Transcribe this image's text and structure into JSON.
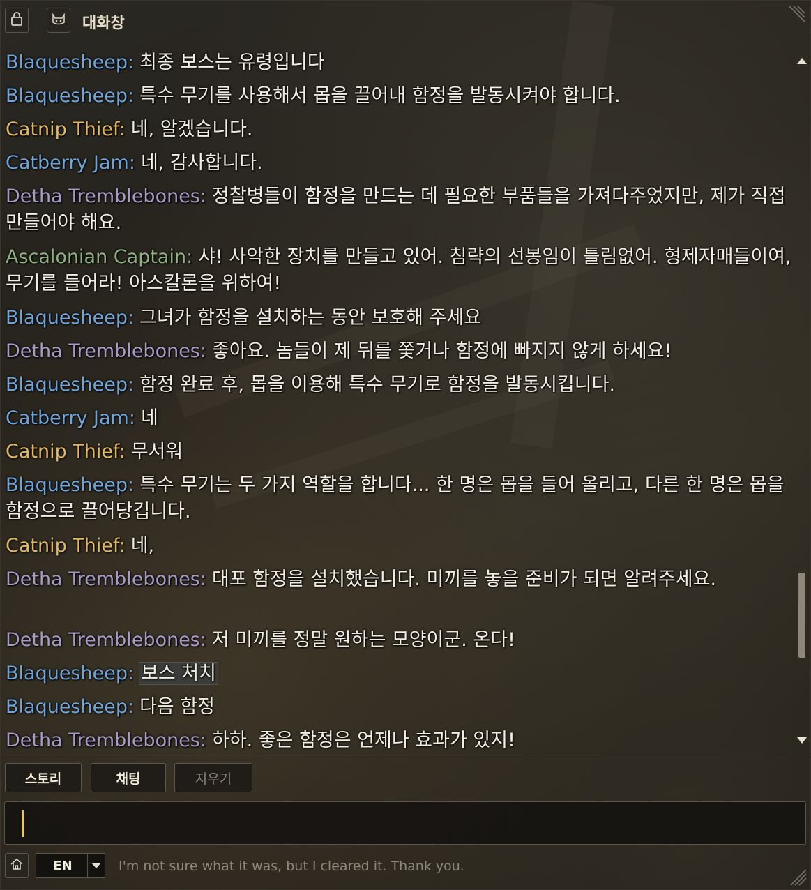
{
  "window": {
    "title": "대화창",
    "icons": {
      "lock": "lock-icon",
      "character": "cat-face-icon",
      "resize": "resize-grip-icon",
      "home": "home-icon"
    }
  },
  "colors": {
    "speaker_blue": "#6fa5d8",
    "speaker_gold": "#e0b861",
    "speaker_purple": "#a79ac5",
    "speaker_green": "#8fb27f",
    "message_text": "#f2ede2",
    "caret": "#e6c26a"
  },
  "messages": [
    {
      "speaker": "Blaquesheep:",
      "text": "최종 보스는 유령입니다"
    },
    {
      "speaker": "Blaquesheep:",
      "text": "특수 무기를 사용해서 몹을 끌어내 함정을 발동시켜야 합니다."
    },
    {
      "speaker": "Catnip Thief:",
      "text": "네, 알겠습니다."
    },
    {
      "speaker": "Catberry Jam:",
      "text": "네, 감사합니다."
    },
    {
      "speaker": "Detha Tremblebones:",
      "text": "정찰병들이 함정을 만드는 데 필요한 부품들을 가져다주었지만, 제가 직접 만들어야 해요."
    },
    {
      "speaker": "Ascalonian Captain:",
      "text": "샤! 사악한 장치를 만들고 있어. 침략의 선봉임이 틀림없어. 형제자매들이여, 무기를 들어라! 아스칼론을 위하여!"
    },
    {
      "speaker": "Blaquesheep:",
      "text": "그녀가 함정을 설치하는 동안 보호해 주세요"
    },
    {
      "speaker": "Detha Tremblebones:",
      "text": "좋아요. 놈들이 제 뒤를 쫓거나 함정에 빠지지 않게 하세요!"
    },
    {
      "speaker": "Blaquesheep:",
      "text": "함정 완료 후, 몹을 이용해 특수 무기로 함정을 발동시킵니다."
    },
    {
      "speaker": "Catberry Jam:",
      "text": "네"
    },
    {
      "speaker": "Catnip Thief:",
      "text": "무서워"
    },
    {
      "speaker": "Blaquesheep:",
      "text": "특수 무기는 두 가지 역할을 합니다... 한 명은 몹을 들어 올리고, 다른 한 명은 몹을 함정으로 끌어당깁니다."
    },
    {
      "speaker": "Catnip Thief:",
      "text": "네,"
    },
    {
      "speaker": "Detha Tremblebones:",
      "text": "대포 함정을 설치했습니다. 미끼를 놓을 준비가 되면 알려주세요."
    },
    {
      "speaker": "Detha Tremblebones:",
      "text": "저 미끼를 정말 원하는 모양이군. 온다!"
    },
    {
      "speaker": "Blaquesheep:",
      "text": "보스 처치"
    },
    {
      "speaker": "Blaquesheep:",
      "text": "다음 함정"
    },
    {
      "speaker": "Detha Tremblebones:",
      "text": "하하. 좋은 함정은 언제나 효과가 있지!"
    }
  ],
  "tabs": {
    "story": "스토리",
    "chat": "채팅",
    "clear": "지우기"
  },
  "input": {
    "value": ""
  },
  "language": {
    "selected": "EN"
  },
  "translation_text": "I'm not sure what it was, but I cleared it. Thank you."
}
